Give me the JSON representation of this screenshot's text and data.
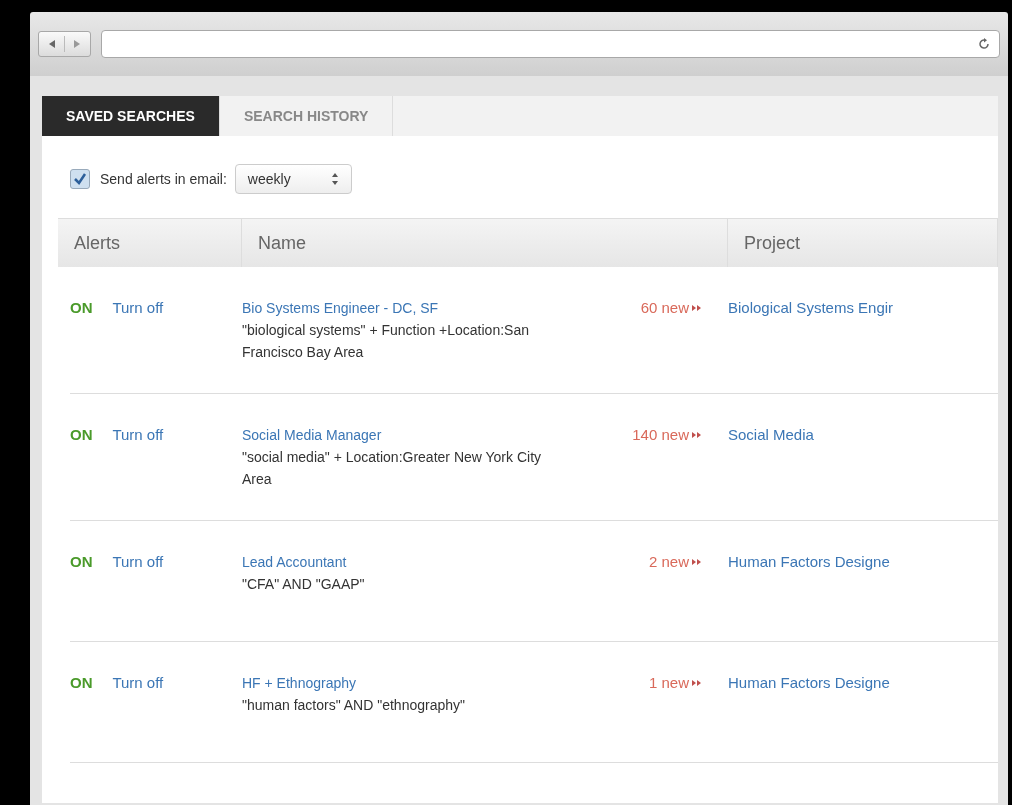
{
  "tabs": [
    {
      "label": "SAVED SEARCHES",
      "selected": true
    },
    {
      "label": "SEARCH HISTORY",
      "selected": false
    }
  ],
  "email_alerts": {
    "label": "Send alerts in email:",
    "checked": true,
    "frequency": "weekly"
  },
  "table": {
    "columns": [
      "Alerts",
      "Name",
      "Project"
    ],
    "rows": [
      {
        "status": "ON",
        "on": true,
        "action": "Turn off",
        "name": "Bio Systems Engineer - DC, SF",
        "query": "\"biological systems\" + Function +Location:San Francisco Bay Area",
        "new_count": "60 new",
        "project": "Biological Systems Engir"
      },
      {
        "status": "ON",
        "on": true,
        "action": "Turn off",
        "name": "Social Media Manager",
        "query": "\"social media\" + Location:Greater New York City Area",
        "new_count": "140 new",
        "project": "Social Media"
      },
      {
        "status": "ON",
        "on": true,
        "action": "Turn off",
        "name": "Lead Accountant",
        "query": "\"CFA\" AND \"GAAP\"",
        "new_count": "2 new",
        "project": "Human Factors Designe"
      },
      {
        "status": "ON",
        "on": true,
        "action": "Turn off",
        "name": "HF + Ethnography",
        "query": "\"human factors\" AND \"ethnography\"",
        "new_count": "1 new",
        "project": "Human Factors Designe"
      }
    ]
  }
}
